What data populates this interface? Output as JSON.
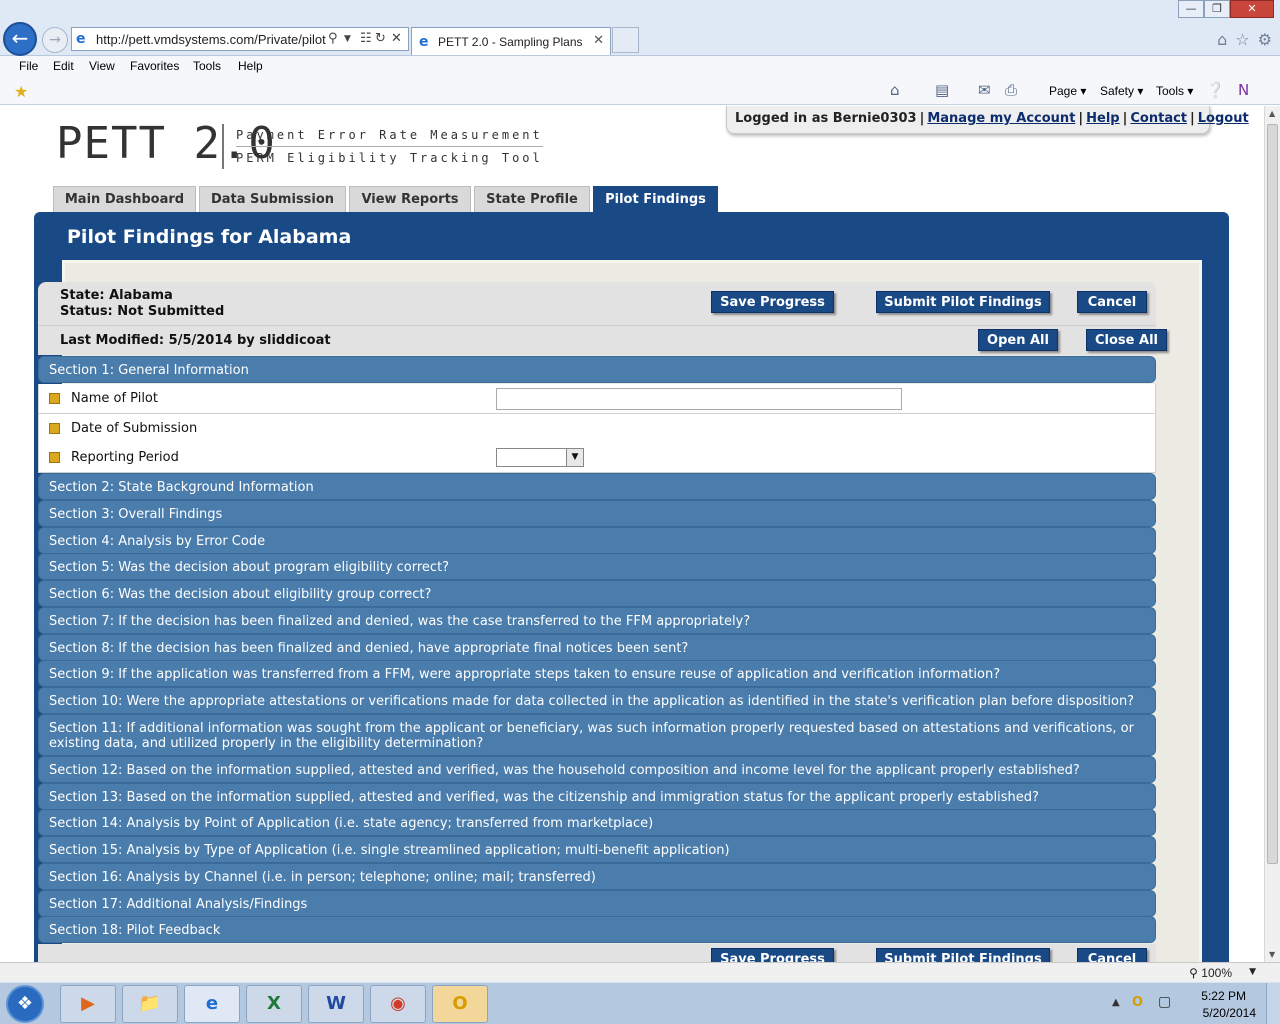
{
  "browser": {
    "url": "http://pett.vmdsystems.com/Private/pilot-",
    "tab_title": "PETT 2.0 - Sampling Plans",
    "menu": [
      "File",
      "Edit",
      "View",
      "Favorites",
      "Tools",
      "Help"
    ],
    "commands": {
      "page": "Page",
      "safety": "Safety",
      "tools": "Tools"
    },
    "zoom": "100%"
  },
  "header": {
    "logo": "PETT 2.0",
    "subtitle_line1": "Payment Error Rate Measurement",
    "subtitle_line2": "PERM Eligibility Tracking Tool",
    "logged_in_text": "Logged in as Bernie0303",
    "links": {
      "manage": "Manage my Account",
      "help": "Help",
      "contact": "Contact",
      "logout": "Logout"
    }
  },
  "nav": {
    "tabs": [
      "Main Dashboard",
      "Data Submission",
      "View Reports",
      "State Profile",
      "Pilot Findings"
    ],
    "active": "Pilot Findings"
  },
  "page": {
    "title": "Pilot Findings for Alabama",
    "state_line": "State: Alabama",
    "status_line": "Status: Not Submitted",
    "last_modified": "Last Modified: 5/5/2014 by sliddicoat",
    "buttons": {
      "save": "Save Progress",
      "submit": "Submit Pilot Findings",
      "cancel": "Cancel",
      "open_all": "Open All",
      "close_all": "Close All"
    },
    "fields": {
      "name_of_pilot": "Name of Pilot",
      "date_of_submission": "Date of Submission",
      "reporting_period": "Reporting Period"
    },
    "sections": [
      "Section 1: General Information",
      "Section 2: State Background Information",
      "Section 3: Overall Findings",
      "Section 4: Analysis by Error Code",
      "Section 5: Was the decision about program eligibility correct?",
      "Section 6: Was the decision about eligibility group correct?",
      "Section 7: If the decision has been finalized and denied, was the case transferred to the FFM appropriately?",
      "Section 8: If the decision has been finalized and denied, have appropriate final notices been sent?",
      "Section 9: If the application was transferred from a FFM, were appropriate steps taken to ensure reuse of application and verification information?",
      "Section 10: Were the appropriate attestations or verifications made for data collected in the application as identified in the state's verification plan before disposition?",
      "Section 11: If additional information was sought from the applicant or beneficiary, was such information properly requested based on attestations and verifications, or existing data, and utilized properly in the eligibility determination?",
      "Section 12: Based on the information supplied, attested and verified, was the household composition and income level for the applicant properly established?",
      "Section 13: Based on the information supplied, attested and verified, was the citizenship and immigration status for the applicant properly established?",
      "Section 14: Analysis by Point of Application (i.e. state agency; transferred from marketplace)",
      "Section 15: Analysis by Type of Application (i.e. single streamlined application; multi-benefit application)",
      "Section 16: Analysis by Channel (i.e. in person; telephone; online; mail; transferred)",
      "Section 17: Additional Analysis/Findings",
      "Section 18: Pilot Feedback"
    ]
  },
  "taskbar": {
    "time": "5:22 PM",
    "date": "5/20/2014"
  }
}
